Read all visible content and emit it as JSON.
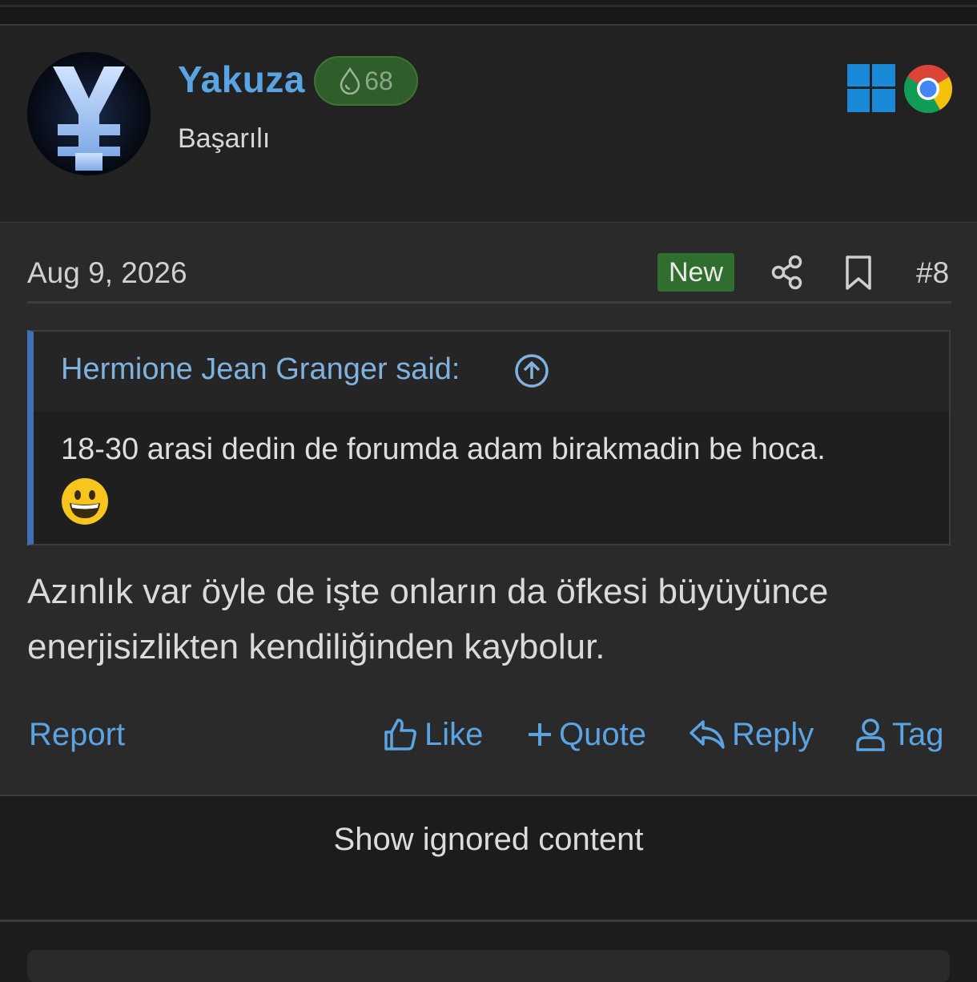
{
  "author": {
    "name": "Yakuza",
    "reputation": "68",
    "title": "Başarılı",
    "avatar_glyph": "yen-icon",
    "os": "windows-icon",
    "browser": "chrome-icon"
  },
  "post": {
    "date": "Aug 9, 2026",
    "new_label": "New",
    "number": "#8",
    "quote": {
      "author_line": "Hermione Jean Granger said:",
      "text": "18-30 arasi dedin de forumda adam birakmadin be hoca.",
      "emoji": "grinning-face-icon"
    },
    "body": "Azınlık var öyle de işte onların da öfkesi büyüyünce enerjisizlikten kendiliğinden kaybolur."
  },
  "actions": {
    "report": "Report",
    "like": "Like",
    "quote": "Quote",
    "reply": "Reply",
    "tag": "Tag"
  },
  "ignored": {
    "label": "Show ignored content"
  },
  "colors": {
    "link": "#5aa4e3",
    "badge_green": "#2f6e2e",
    "quote_accent": "#3d71b3"
  }
}
